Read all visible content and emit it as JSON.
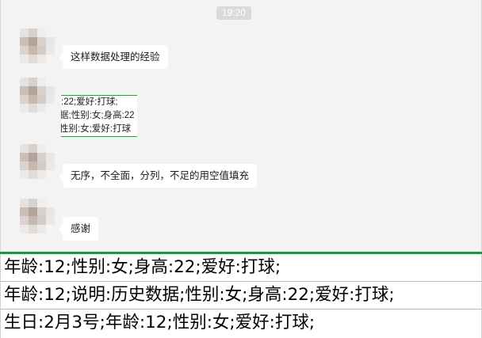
{
  "chat": {
    "timestamp": "19:20",
    "messages": [
      {
        "type": "text",
        "text": "这样数据处理的经验"
      },
      {
        "type": "image",
        "lines": [
          ":22;爱好:打球;",
          "据;性别:女;身高:22",
          "性别:女;爱好:打球"
        ]
      },
      {
        "type": "text",
        "text": "无序，不全面，分列，不足的用空值填充"
      },
      {
        "type": "text",
        "text": "感谢"
      }
    ]
  },
  "data_lines": [
    "年龄:12;性别:女;身高:22;爱好:打球;",
    "年龄:12;说明:历史数据;性别:女;身高:22;爱好:打球;",
    "生日:2月3号;年龄:12;性别:女;爱好:打球;"
  ],
  "colors": {
    "chat_background": "#f3f3f3",
    "bubble": "#ffffff",
    "accent_green": "#2e8b47",
    "timestamp_bg": "#dadada"
  }
}
